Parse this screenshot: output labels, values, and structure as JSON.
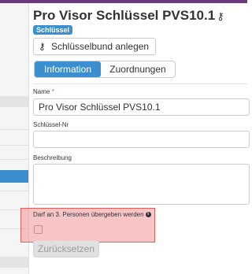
{
  "page": {
    "title": "Pro Visor Schlüssel PVS10.1",
    "title_icon": "key-icon",
    "badge": "Schlüssel",
    "keyring_button": "Schlüsselbund anlegen"
  },
  "tabs": [
    {
      "label": "Information",
      "active": true
    },
    {
      "label": "Zuordnungen",
      "active": false
    }
  ],
  "form": {
    "name_label": "Name",
    "name_required": "*",
    "name_value": "Pro Visor Schlüssel PVS10.1",
    "keynum_label": "Schlüssel-Nr",
    "keynum_value": "",
    "description_label": "Beschreibung",
    "description_value": "",
    "share_label": "Darf an 3. Personen übergeben werden",
    "share_info_icon": "info-icon",
    "share_checked": false,
    "reset_button": "Zurücksetzen"
  },
  "colors": {
    "accent": "#3b8fcf",
    "topbar": "#6b3a7a",
    "highlight": "#f09696",
    "required": "#d9534f"
  }
}
